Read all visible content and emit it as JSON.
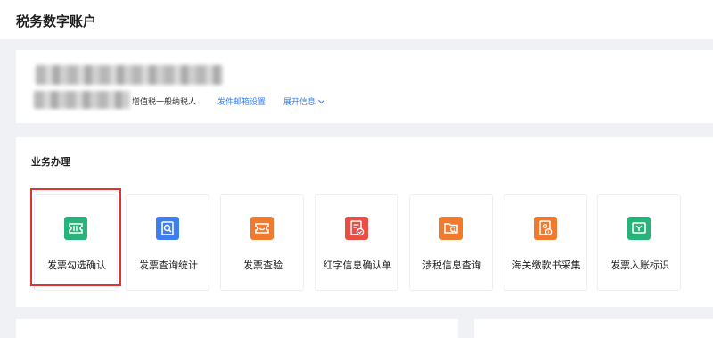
{
  "header": {
    "title": "税务数字账户"
  },
  "account": {
    "taxpayer_type": "增值税一般纳税人",
    "mail_setting_link": "发件邮箱设置",
    "expand_link": "展开信息"
  },
  "business": {
    "section_title": "业务办理",
    "cards": [
      {
        "label": "发票勾选确认",
        "icon": "ticket-icon",
        "color": "#27b37a"
      },
      {
        "label": "发票查询统计",
        "icon": "document-search-icon",
        "color": "#3d7ef0"
      },
      {
        "label": "发票查验",
        "icon": "ticket-check-icon",
        "color": "#f07b2e"
      },
      {
        "label": "红字信息确认单",
        "icon": "red-document-check-icon",
        "color": "#ea4d46"
      },
      {
        "label": "涉税信息查询",
        "icon": "folder-search-icon",
        "color": "#f07b2e"
      },
      {
        "label": "海关缴款书采集",
        "icon": "document-lock-icon",
        "color": "#f07b2e"
      },
      {
        "label": "发票入账标识",
        "icon": "ticket-tag-icon",
        "color": "#27b37a"
      }
    ]
  }
}
